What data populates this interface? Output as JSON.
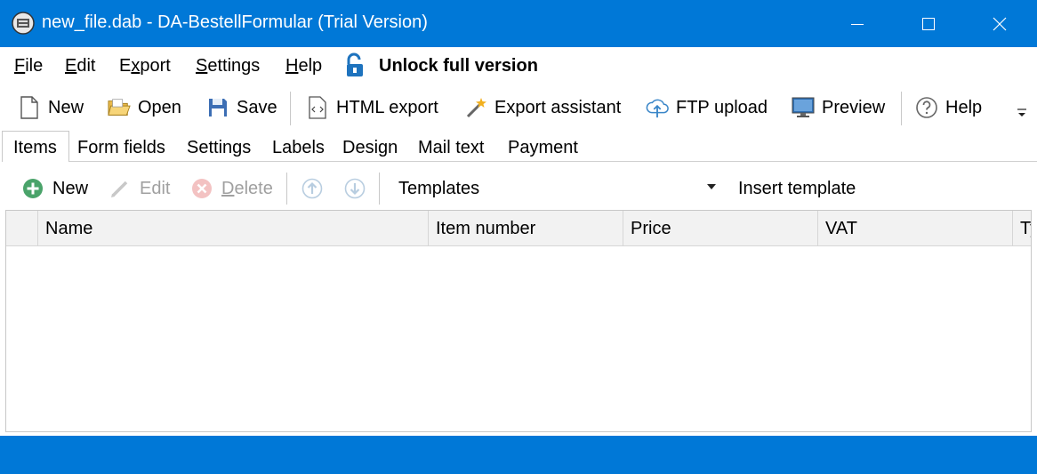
{
  "window": {
    "title": "new_file.dab - DA-BestellFormular (Trial Version)"
  },
  "menubar": {
    "items": [
      {
        "label": "File"
      },
      {
        "label": "Edit"
      },
      {
        "label": "Export"
      },
      {
        "label": "Settings"
      },
      {
        "label": "Help"
      }
    ],
    "unlock_label": "Unlock full version"
  },
  "toolbar": {
    "new": "New",
    "open": "Open",
    "save": "Save",
    "html_export": "HTML export",
    "export_assistant": "Export assistant",
    "ftp_upload": "FTP upload",
    "preview": "Preview",
    "help": "Help"
  },
  "tabs": [
    {
      "label": "Items",
      "active": true
    },
    {
      "label": "Form fields"
    },
    {
      "label": "Settings"
    },
    {
      "label": "Labels"
    },
    {
      "label": "Design"
    },
    {
      "label": "Mail text"
    },
    {
      "label": "Payment"
    }
  ],
  "items_toolbar": {
    "new": "New",
    "edit": "Edit",
    "delete": "Delete",
    "templates": "Templates",
    "insert_template": "Insert template"
  },
  "grid": {
    "columns": [
      "Name",
      "Item number",
      "Price",
      "VAT",
      "Ty"
    ]
  },
  "colors": {
    "accent": "#0078d7"
  }
}
